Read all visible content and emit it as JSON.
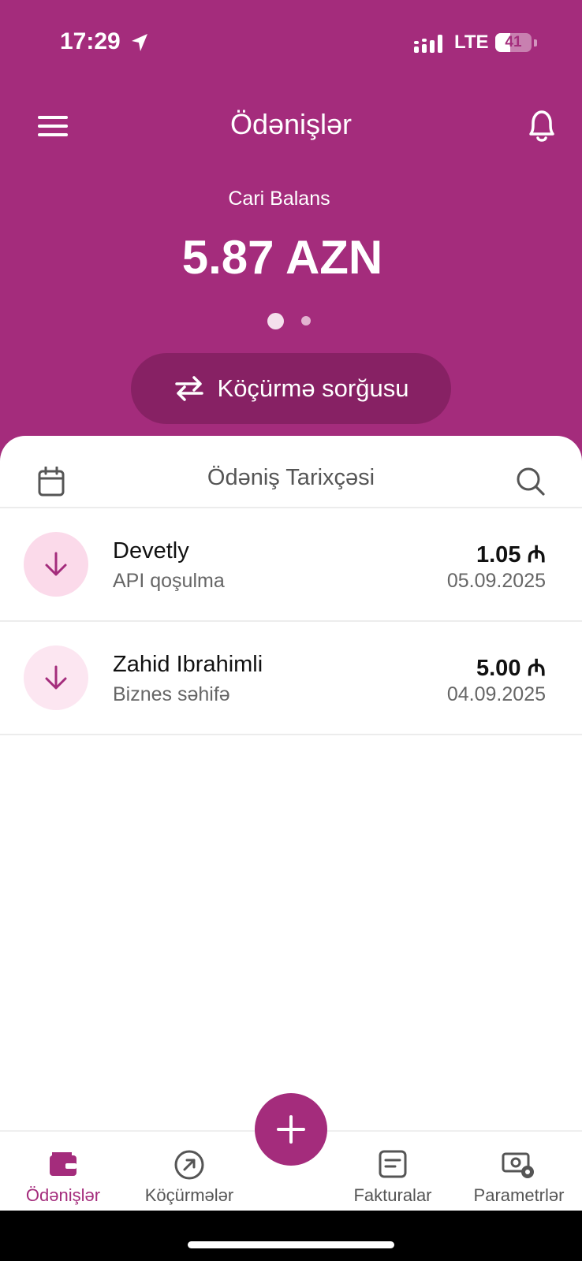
{
  "status_bar": {
    "time": "17:29",
    "network": "LTE",
    "battery": "41",
    "battery_fraction": 0.41
  },
  "header": {
    "title": "Ödənişlər",
    "balance_label": "Cari Balans",
    "balance_value": "5.87 AZN",
    "pager_active": 1,
    "pager_count": 2,
    "transfer_button_label": "Köçürmə sorğusu"
  },
  "history": {
    "title": "Ödəniş Tarixçəsi",
    "items": [
      {
        "name": "Devetly",
        "subtitle": "API qoşulma",
        "amount": "1.05 ₼",
        "date": "05.09.2025",
        "icon": "arrow-down-icon"
      },
      {
        "name": "Zahid Ibrahimli",
        "subtitle": "Biznes səhifə",
        "amount": "5.00 ₼",
        "date": "04.09.2025",
        "icon": "arrow-down-icon"
      }
    ]
  },
  "bottom_nav": {
    "items": [
      {
        "label": "Ödənişlər",
        "icon": "wallet-icon",
        "active": true
      },
      {
        "label": "Köçürmələr",
        "icon": "arrow-up-right-circle-icon",
        "active": false
      },
      {
        "label": "Fakturalar",
        "icon": "document-icon",
        "active": false
      },
      {
        "label": "Parametrlər",
        "icon": "money-settings-icon",
        "active": false
      }
    ],
    "fab_icon": "plus-icon"
  },
  "colors": {
    "brand": "#a42c7c",
    "brand_dark": "#872164",
    "icon_bg_light": "#fbe0ee",
    "text_secondary": "#666666"
  }
}
